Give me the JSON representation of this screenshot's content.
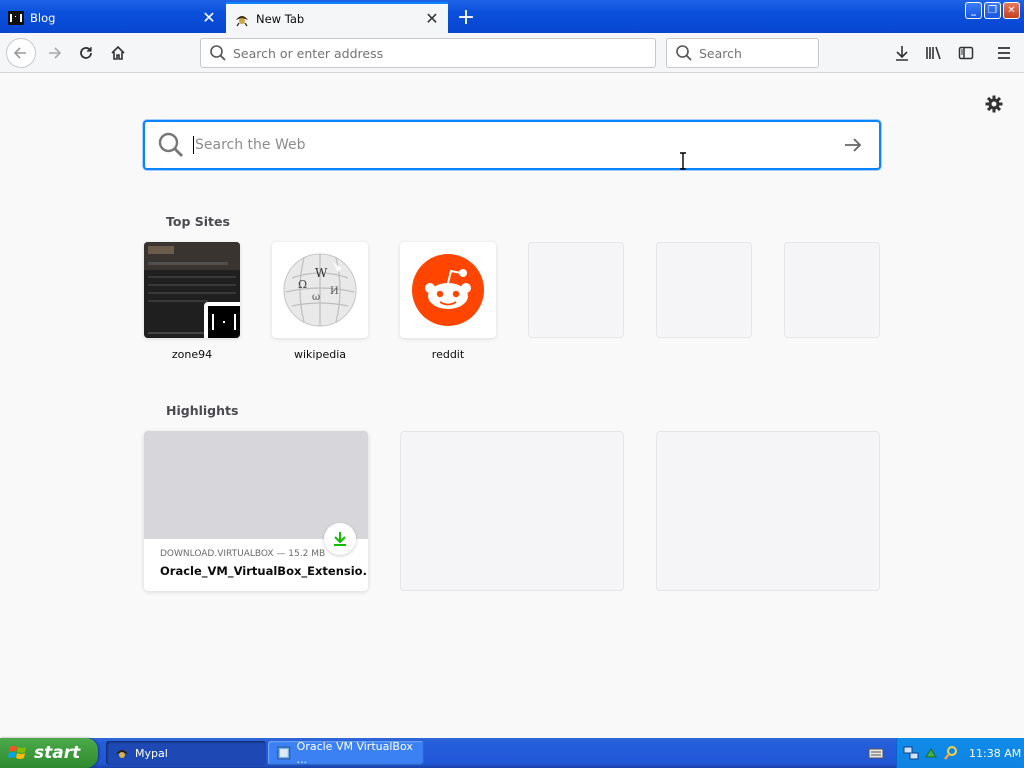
{
  "browser": {
    "tabs": [
      {
        "title": "Blog",
        "active": false
      },
      {
        "title": "New Tab",
        "active": true
      }
    ],
    "window_controls": {
      "minimize": "_",
      "restore": "❐",
      "close": "✕"
    },
    "url_placeholder": "Search or enter address",
    "search_placeholder": "Search"
  },
  "newtab": {
    "search_placeholder": "Search the Web",
    "top_sites_title": "Top Sites",
    "top_sites": [
      {
        "label": "zone94",
        "icon": "zone94-logo"
      },
      {
        "label": "wikipedia",
        "icon": "wikipedia-globe"
      },
      {
        "label": "reddit",
        "icon": "reddit-alien"
      },
      {
        "label": "",
        "icon": ""
      },
      {
        "label": "",
        "icon": ""
      },
      {
        "label": "",
        "icon": ""
      }
    ],
    "highlights_title": "Highlights",
    "highlights": [
      {
        "meta": "DOWNLOAD.VIRTUALBOX — 15.2 MB",
        "title": "Oracle_VM_VirtualBox_Extensio...",
        "badge": "download-icon"
      }
    ]
  },
  "taskbar": {
    "start_label": "start",
    "tasks": [
      {
        "label": "Mypal",
        "active": true
      },
      {
        "label": "Oracle VM VirtualBox ...",
        "active": false
      }
    ],
    "clock": "11:38 AM"
  },
  "colors": {
    "accent": "#0a84ff",
    "xp_blue": "#245edb",
    "start_green": "#3c9a3c",
    "reddit": "#ff4500",
    "download_green": "#12bc00"
  }
}
